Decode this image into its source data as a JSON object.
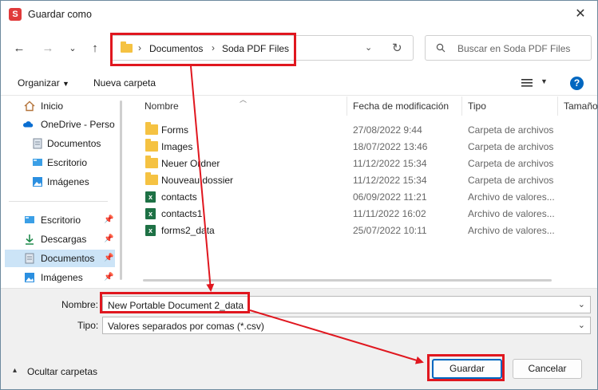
{
  "window": {
    "title": "Guardar como",
    "app_icon_letter": "S"
  },
  "nav": {
    "breadcrumbs": [
      "Documentos",
      "Soda PDF Files"
    ],
    "search_placeholder": "Buscar en Soda PDF Files"
  },
  "toolbar": {
    "organize_label": "Organizar",
    "new_folder_label": "Nueva carpeta"
  },
  "sidebar": {
    "items": [
      {
        "label": "Inicio",
        "icon": "home-icon"
      },
      {
        "label": "OneDrive - Perso",
        "icon": "cloud-icon"
      },
      {
        "label": "Documentos",
        "icon": "document-icon"
      },
      {
        "label": "Escritorio",
        "icon": "desktop-icon"
      },
      {
        "label": "Imágenes",
        "icon": "image-icon"
      },
      {
        "label": "Escritorio",
        "icon": "desktop-icon",
        "pinned": true
      },
      {
        "label": "Descargas",
        "icon": "download-icon",
        "pinned": true
      },
      {
        "label": "Documentos",
        "icon": "document-icon",
        "pinned": true,
        "selected": true
      },
      {
        "label": "Imágenes",
        "icon": "image-icon",
        "pinned": true
      }
    ]
  },
  "filelist": {
    "columns": [
      "Nombre",
      "Fecha de modificación",
      "Tipo",
      "Tamaño"
    ],
    "rows": [
      {
        "name": "Forms",
        "date": "27/08/2022 9:44",
        "type": "Carpeta de archivos",
        "icon": "folder-icon"
      },
      {
        "name": "Images",
        "date": "18/07/2022 13:46",
        "type": "Carpeta de archivos",
        "icon": "folder-icon"
      },
      {
        "name": "Neuer Ordner",
        "date": "11/12/2022 15:34",
        "type": "Carpeta de archivos",
        "icon": "folder-icon"
      },
      {
        "name": "Nouveau dossier",
        "date": "11/12/2022 15:34",
        "type": "Carpeta de archivos",
        "icon": "folder-icon"
      },
      {
        "name": "contacts",
        "date": "06/09/2022 11:21",
        "type": "Archivo de valores...",
        "icon": "excel-icon"
      },
      {
        "name": "contacts1",
        "date": "11/11/2022 16:02",
        "type": "Archivo de valores...",
        "icon": "excel-icon"
      },
      {
        "name": "forms2_data",
        "date": "25/07/2022 10:11",
        "type": "Archivo de valores...",
        "icon": "excel-icon"
      }
    ]
  },
  "form": {
    "name_label": "Nombre:",
    "name_value": "New Portable Document 2_data",
    "type_label": "Tipo:",
    "type_value": "Valores separados por comas (*.csv)",
    "hide_folders_label": "Ocultar carpetas",
    "save_label": "Guardar",
    "cancel_label": "Cancelar"
  },
  "colors": {
    "annotation": "#e0171f",
    "accent": "#0067c0",
    "selected_bg": "#cce4f7"
  }
}
